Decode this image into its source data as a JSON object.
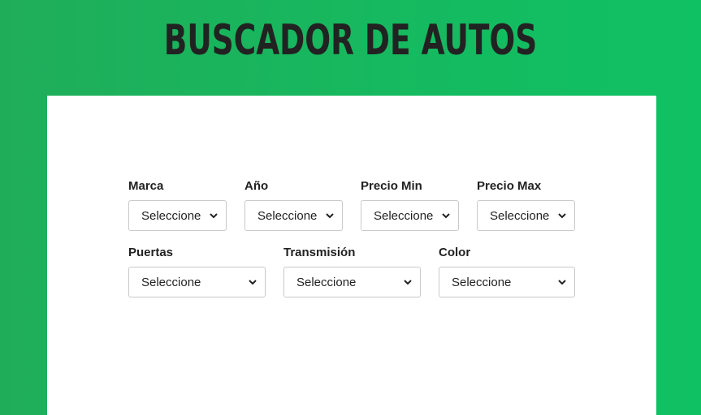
{
  "header": {
    "title": "BUSCADOR DE AUTOS"
  },
  "colors": {
    "background_green": "#16b95f",
    "card_background": "#ffffff",
    "text_dark": "#222222",
    "select_border": "#c9c9c9"
  },
  "filters": {
    "row1": [
      {
        "label": "Marca",
        "selected": "Seleccione"
      },
      {
        "label": "Año",
        "selected": "Seleccione"
      },
      {
        "label": "Precio Min",
        "selected": "Seleccione"
      },
      {
        "label": "Precio Max",
        "selected": "Seleccione"
      }
    ],
    "row2": [
      {
        "label": "Puertas",
        "selected": "Seleccione"
      },
      {
        "label": "Transmisión",
        "selected": "Seleccione"
      },
      {
        "label": "Color",
        "selected": "Seleccione"
      }
    ]
  },
  "icons": {
    "select_arrow": "chevron-down-icon"
  }
}
